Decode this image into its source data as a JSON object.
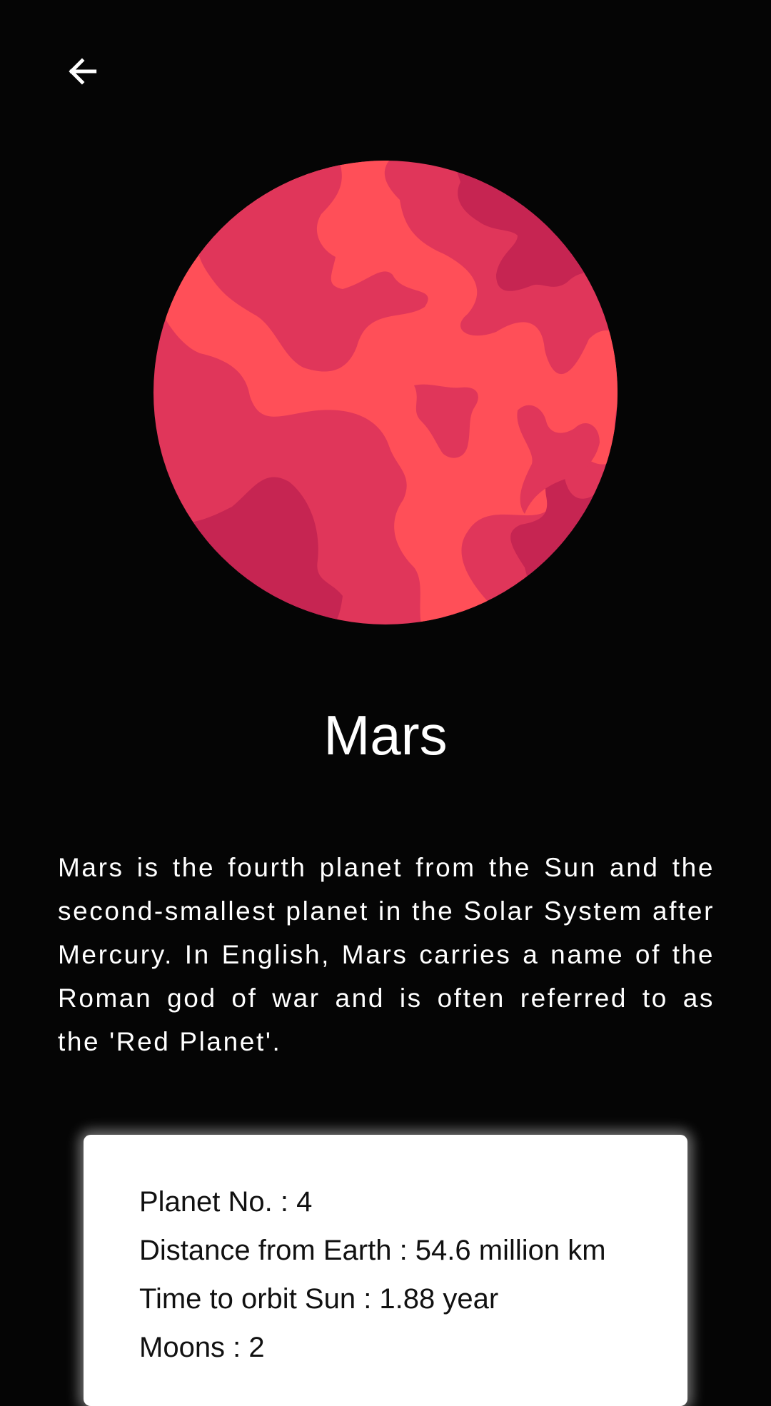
{
  "nav": {
    "back_icon": "arrow-left-icon"
  },
  "planet": {
    "name": "Mars",
    "image_icon": "mars-planet-illustration",
    "description": "Mars is the fourth planet from the Sun and the second-smallest planet in the Solar System after Mercury. In English, Mars carries a name of the Roman god of war and is often referred to as the 'Red Planet'."
  },
  "info": {
    "planet_no": "Planet No. : 4",
    "distance": "Distance from Earth : 54.6 million km",
    "orbit_time": "Time to orbit Sun : 1.88 year",
    "moons": "Moons : 2"
  },
  "colors": {
    "background": "#050505",
    "planet_light": "#FF4F58",
    "planet_mid": "#E0365A",
    "planet_dark": "#C62552",
    "card": "#FFFFFF",
    "text_on_card": "#111111"
  }
}
